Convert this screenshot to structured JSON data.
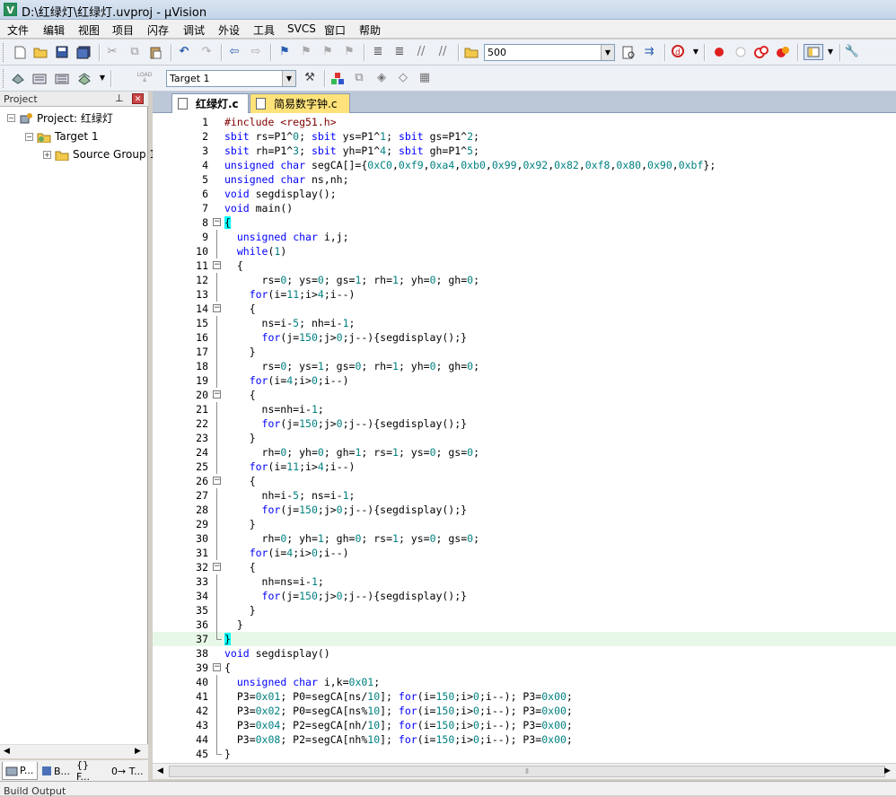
{
  "window": {
    "title": "D:\\红绿灯\\红绿灯.uvproj - µVision",
    "app_icon": "V"
  },
  "menu": [
    "文件",
    "编辑",
    "视图",
    "项目",
    "闪存",
    "调试",
    "外设",
    "工具",
    "SVCS",
    "窗口",
    "帮助"
  ],
  "toolbar": {
    "find_value": "500",
    "target_value": "Target 1",
    "load_label": "LOAD"
  },
  "project_panel": {
    "title": "Project",
    "tree": [
      {
        "label": "Project: 红绿灯"
      },
      {
        "label": "Target 1"
      },
      {
        "label": "Source Group 1"
      }
    ],
    "tabs": [
      "P...",
      "B...",
      "{} F...",
      "0→ T..."
    ]
  },
  "editor": {
    "tabs": [
      "红绿灯.c",
      "简易数字钟.c"
    ],
    "lines": [
      "#include <reg51.h>",
      "sbit rs=P1^0; sbit ys=P1^1; sbit gs=P1^2;",
      "sbit rh=P1^3; sbit yh=P1^4; sbit gh=P1^5;",
      "unsigned char segCA[]={0xC0,0xf9,0xa4,0xb0,0x99,0x92,0x82,0xf8,0x80,0x90,0xbf};",
      "unsigned char ns,nh;",
      "void segdisplay();",
      "void main()",
      "{",
      "  unsigned char i,j;",
      "  while(1)",
      "  {",
      "      rs=0; ys=0; gs=1; rh=1; yh=0; gh=0;",
      "    for(i=11;i>4;i--)",
      "    {",
      "      ns=i-5; nh=i-1;",
      "      for(j=150;j>0;j--){segdisplay();}",
      "    }",
      "      rs=0; ys=1; gs=0; rh=1; yh=0; gh=0;",
      "    for(i=4;i>0;i--)",
      "    {",
      "      ns=nh=i-1;",
      "      for(j=150;j>0;j--){segdisplay();}",
      "    }",
      "      rh=0; yh=0; gh=1; rs=1; ys=0; gs=0;",
      "    for(i=11;i>4;i--)",
      "    {",
      "      nh=i-5; ns=i-1;",
      "      for(j=150;j>0;j--){segdisplay();}",
      "    }",
      "      rh=0; yh=1; gh=0; rs=1; ys=0; gs=0;",
      "    for(i=4;i>0;i--)",
      "    {",
      "      nh=ns=i-1;",
      "      for(j=150;j>0;j--){segdisplay();}",
      "    }",
      "  }",
      "}",
      "void segdisplay()",
      "{",
      "  unsigned char i,k=0x01;",
      "  P3=0x01; P0=segCA[ns/10]; for(i=150;i>0;i--); P3=0x00;",
      "  P3=0x02; P0=segCA[ns%10]; for(i=150;i>0;i--); P3=0x00;",
      "  P3=0x04; P2=segCA[nh/10]; for(i=150;i>0;i--); P3=0x00;",
      "  P3=0x08; P2=segCA[nh%10]; for(i=150;i>0;i--); P3=0x00;",
      "}"
    ],
    "highlight_line": 37,
    "colors": {
      "keyword": "#0000ff",
      "number": "#008080",
      "string": "#800000",
      "brace_match": "#00ffff"
    }
  },
  "bottom_panel": {
    "label": "Build Output"
  }
}
